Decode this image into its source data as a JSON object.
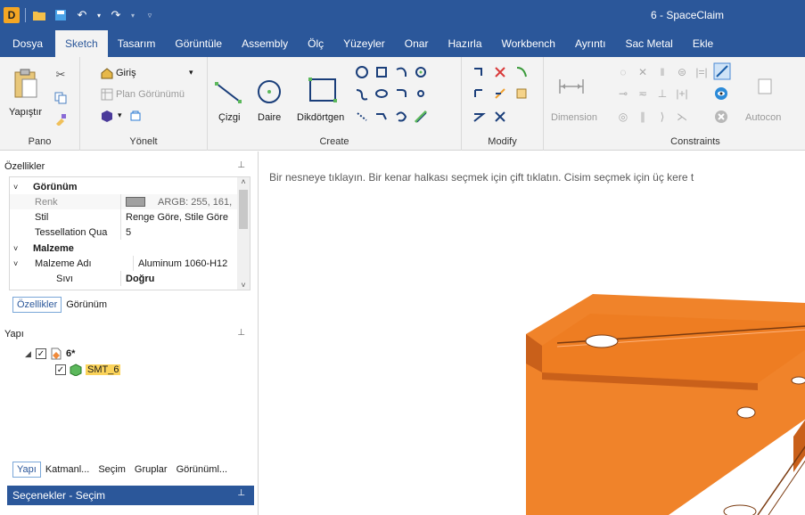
{
  "window": {
    "title": "6 - SpaceClaim"
  },
  "quick_access": {
    "logo": "D"
  },
  "tabs": [
    "Dosya",
    "Sketch",
    "Tasarım",
    "Görüntüle",
    "Assembly",
    "Ölç",
    "Yüzeyler",
    "Onar",
    "Hazırla",
    "Workbench",
    "Ayrıntı",
    "Sac Metal",
    "Ekle"
  ],
  "ribbon": {
    "pano": {
      "label": "Pano",
      "paste": "Yapıştır"
    },
    "yonelt": {
      "label": "Yönelt",
      "giris": "Giriş",
      "plan": "Plan Görünümü"
    },
    "create": {
      "label": "Create",
      "line": "Çizgi",
      "circle": "Daire",
      "rect": "Dikdörtgen"
    },
    "modify": {
      "label": "Modify"
    },
    "constraints": {
      "label": "Constraints",
      "dimension": "Dimension",
      "autoconstrain": "Autocon"
    }
  },
  "properties": {
    "header": "Özellikler",
    "rows": [
      {
        "type": "cat",
        "key": "Görünüm"
      },
      {
        "type": "row",
        "key": "Renk",
        "value": "ARGB: 255, 161,",
        "color": "#a1a1a1"
      },
      {
        "type": "row",
        "key": "Stil",
        "value": "Renge Göre, Stile Göre"
      },
      {
        "type": "row",
        "key": "Tessellation Qua",
        "value": "5"
      },
      {
        "type": "cat",
        "key": "Malzeme"
      },
      {
        "type": "row",
        "key": "Malzeme Adı",
        "value": "Aluminum 1060-H12"
      },
      {
        "type": "row",
        "key": "Sıvı",
        "value": "Doğru"
      }
    ],
    "tabs": [
      "Özellikler",
      "Görünüm"
    ]
  },
  "structure": {
    "header": "Yapı",
    "root": "6*",
    "child": "SMT_6"
  },
  "bottom_tabs": [
    "Yapı",
    "Katmanl...",
    "Seçim",
    "Gruplar",
    "Görünüml..."
  ],
  "selection_bar": "Seçenekler - Seçim",
  "canvas": {
    "hint": "Bir nesneye tıklayın. Bir kenar halkası seçmek için çift tıklatın. Cisim seçmek için üç kere t",
    "part_color": "#f0832a"
  }
}
